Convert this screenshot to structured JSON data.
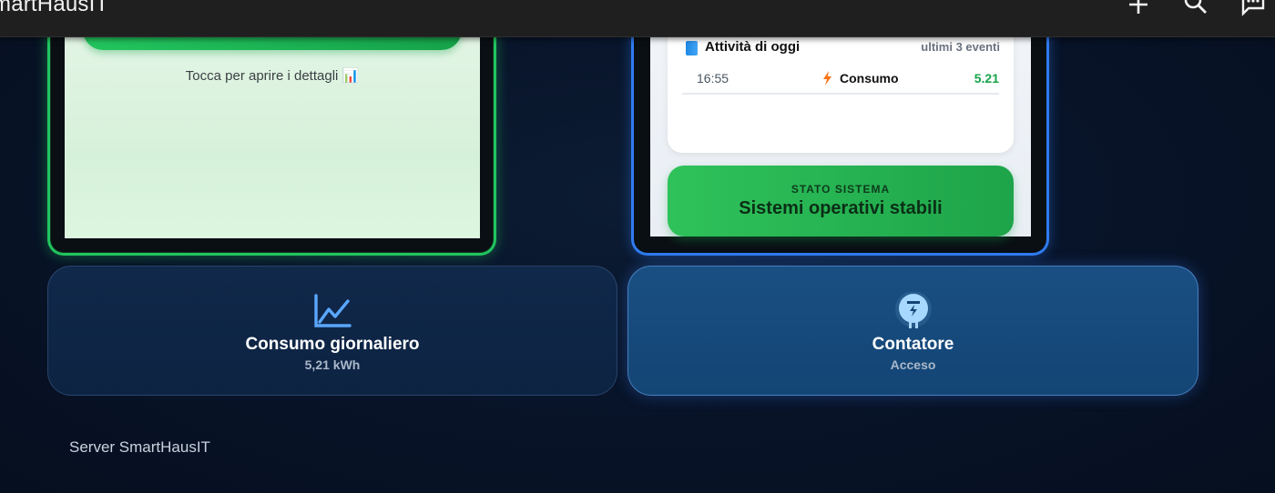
{
  "app": {
    "title": "martHausIT"
  },
  "topbar_icons": [
    "add-icon",
    "search-icon",
    "feedback-icon"
  ],
  "card_green": {
    "hint": "Tocca per aprire i dettagli 📊"
  },
  "card_blue": {
    "activity_title": "Attività di oggi",
    "activity_note": "ultimi 3 eventi",
    "events": [
      {
        "time": "16:55",
        "label": "Consumo",
        "value": "5.21"
      }
    ],
    "status_kicker": "STATO SISTEMA",
    "status_message": "Sistemi operativi stabili"
  },
  "tiles": {
    "consumo": {
      "title": "Consumo giornaliero",
      "subtitle": "5,21 kWh"
    },
    "contatore": {
      "title": "Contatore",
      "subtitle": "Acceso"
    }
  },
  "footer": {
    "text": "Server SmartHausIT"
  },
  "colors": {
    "green": "#22c55e",
    "blue": "#2f7bf0",
    "value_green": "#16a34a"
  }
}
